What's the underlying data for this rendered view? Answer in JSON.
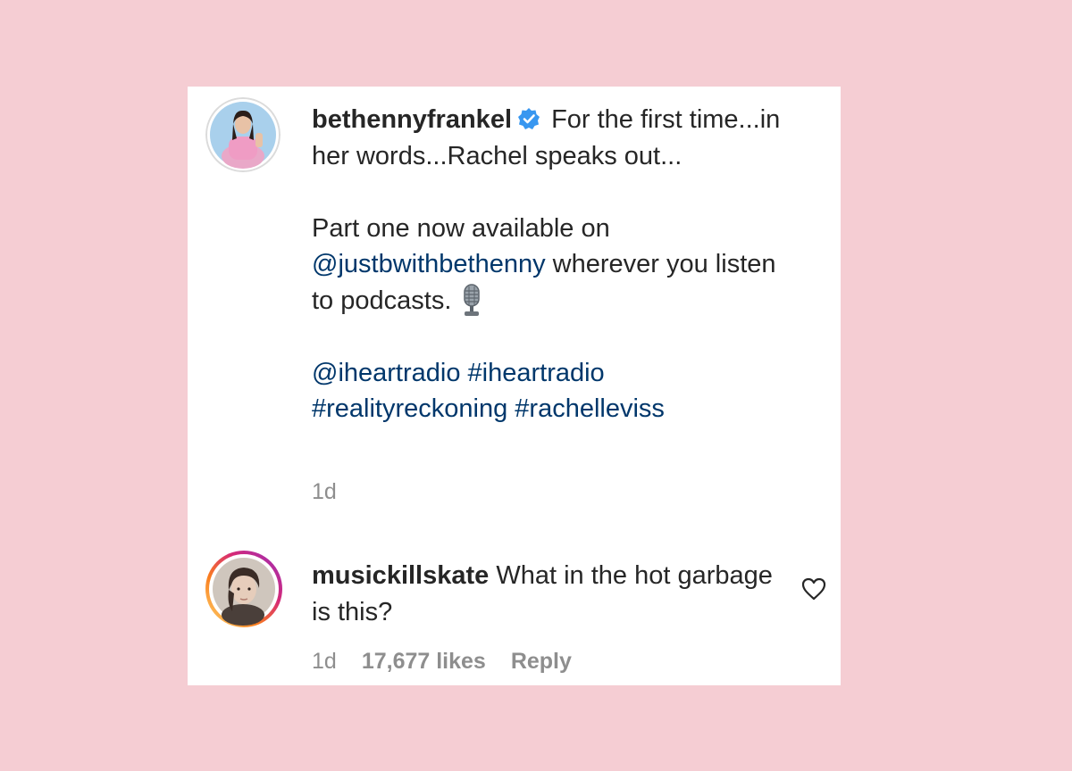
{
  "post": {
    "username": "bethennyfrankel",
    "caption_line1": "For the first time...in her words...Rachel speaks out...",
    "caption_line2_prefix": "Part one now available on ",
    "mention_podcast": "@justbwithbethenny",
    "caption_line2_suffix": " wherever you listen to podcasts.",
    "mic_icon": "microphone-emoji",
    "tags_mention": "@iheartradio",
    "tag1": "#iheartradio",
    "tag2": "#realityreckoning",
    "tag3": "#rachelleviss",
    "time": "1d"
  },
  "comment": {
    "username": "musickillskate",
    "text": "What in the hot garbage is this?",
    "time": "1d",
    "likes": "17,677 likes",
    "reply_label": "Reply",
    "like_icon": "heart-outline-icon"
  },
  "colors": {
    "background": "#f5cdd3",
    "card": "#ffffff",
    "text": "#262626",
    "link": "#00376b",
    "muted": "#8e8e8e",
    "verified": "#3897f0"
  }
}
